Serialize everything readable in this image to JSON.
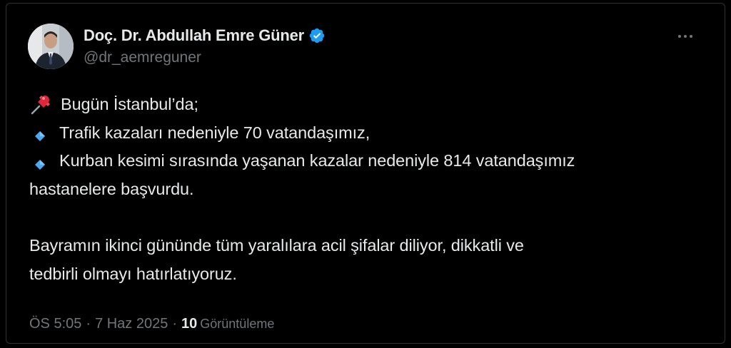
{
  "tweet": {
    "author": {
      "display_name": "Doç. Dr. Abdullah Emre Güner",
      "handle": "@dr_aemreguner",
      "verified": true
    },
    "body": {
      "line1": "Bugün İstanbul’da;",
      "line2": "Trafik kazaları nedeniyle 70 vatandaşımız,",
      "line3": "Kurban kesimi sırasında yaşanan kazalar nedeniyle 814 vatandaşımız",
      "line4": "hastanelere başvurdu.",
      "line5": "Bayramın ikinci gününde tüm yaralılara acil şifalar diliyor, dikkatli ve",
      "line6": "tedbirli olmayı hatırlatıyoruz."
    },
    "meta": {
      "time": "ÖS 5:05",
      "separator": "·",
      "date": "7 Haz 2025",
      "views_count": "10",
      "views_label": "Görüntüleme"
    },
    "icons": {
      "pin": "pushpin-icon",
      "bullet": "small-blue-diamond-icon",
      "verified": "verified-badge-icon",
      "more": "more-options-icon"
    },
    "colors": {
      "background": "#000000",
      "text_primary": "#e7e9ea",
      "text_secondary": "#71767b",
      "verified_blue": "#1d9bf0",
      "diamond_blue": "#4aa8f0",
      "pin_red": "#e0263a"
    }
  }
}
